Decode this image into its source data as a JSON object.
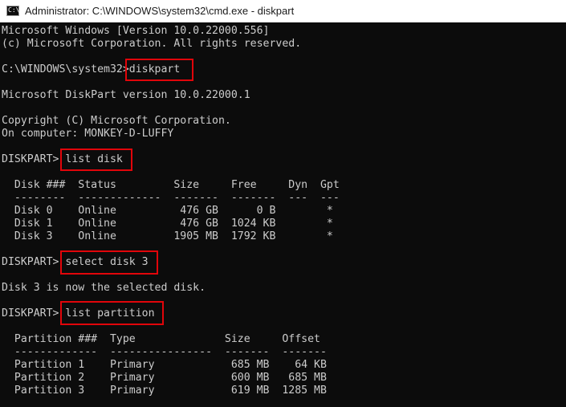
{
  "window": {
    "title": "Administrator: C:\\WINDOWS\\system32\\cmd.exe - diskpart",
    "icon": "cmd-icon",
    "icon_glyph": "C:\\_"
  },
  "colors": {
    "console_background": "#0c0c0c",
    "console_text": "#cccccc",
    "highlight_box": "#e1050a",
    "titlebar_background": "#ffffff"
  },
  "console": {
    "lines": [
      "Microsoft Windows [Version 10.0.22000.556]",
      "(c) Microsoft Corporation. All rights reserved.",
      "",
      "C:\\WINDOWS\\system32>diskpart",
      "",
      "Microsoft DiskPart version 10.0.22000.1",
      "",
      "Copyright (C) Microsoft Corporation.",
      "On computer: MONKEY-D-LUFFY",
      "",
      "DISKPART> list disk",
      "",
      "  Disk ###  Status         Size     Free     Dyn  Gpt",
      "  --------  -------------  -------  -------  ---  ---",
      "  Disk 0    Online          476 GB      0 B        *",
      "  Disk 1    Online          476 GB  1024 KB        *",
      "  Disk 3    Online         1905 MB  1792 KB        *",
      "",
      "DISKPART> select disk 3",
      "",
      "Disk 3 is now the selected disk.",
      "",
      "DISKPART> list partition",
      "",
      "  Partition ###  Type              Size     Offset",
      "  -------------  ----------------  -------  -------",
      "  Partition 1    Primary            685 MB    64 KB",
      "  Partition 2    Primary            600 MB   685 MB",
      "  Partition 3    Primary            619 MB  1285 MB"
    ],
    "highlighted_commands": [
      "diskpart",
      "list disk",
      "select disk 3",
      "list partition"
    ]
  }
}
